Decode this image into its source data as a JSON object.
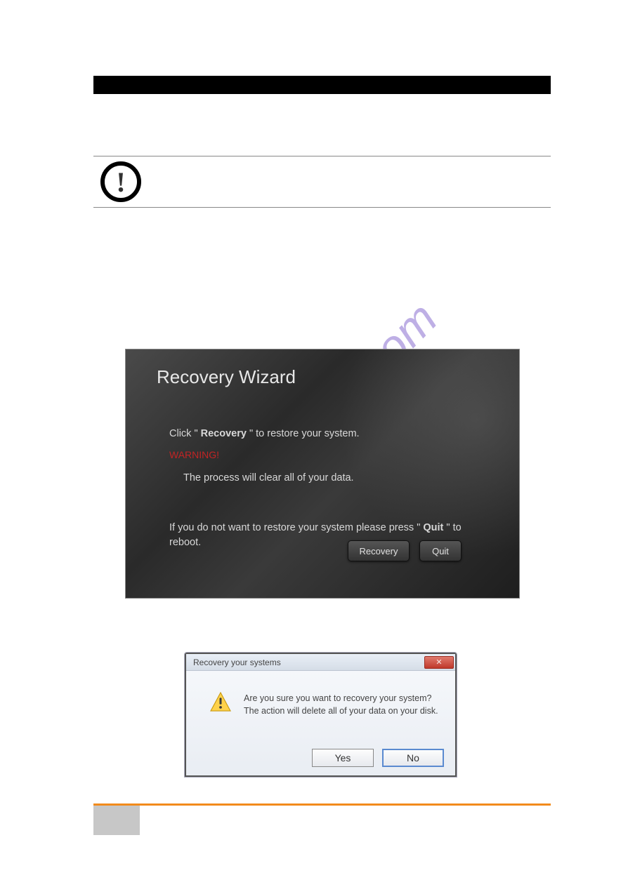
{
  "caution_icon_glyph": "!",
  "wizard": {
    "title": "Recovery Wizard",
    "line1_pre": "Click \" ",
    "line1_bold": "Recovery",
    "line1_post": " \" to restore your system.",
    "warning_label": "WARNING!",
    "warning_text": "The process will clear all of your data.",
    "line3_pre": "If you do not want to restore your system please press \" ",
    "line3_bold": "Quit",
    "line3_post": " \" to reboot.",
    "recovery_btn": "Recovery",
    "quit_btn": "Quit"
  },
  "msgbox": {
    "title": "Recovery your systems",
    "close_glyph": "✕",
    "line1": "Are you sure you want to recovery your system?",
    "line2": "The action will delete all of your data on your disk.",
    "yes": "Yes",
    "no": "No"
  },
  "watermark_text": "manualslive.com"
}
